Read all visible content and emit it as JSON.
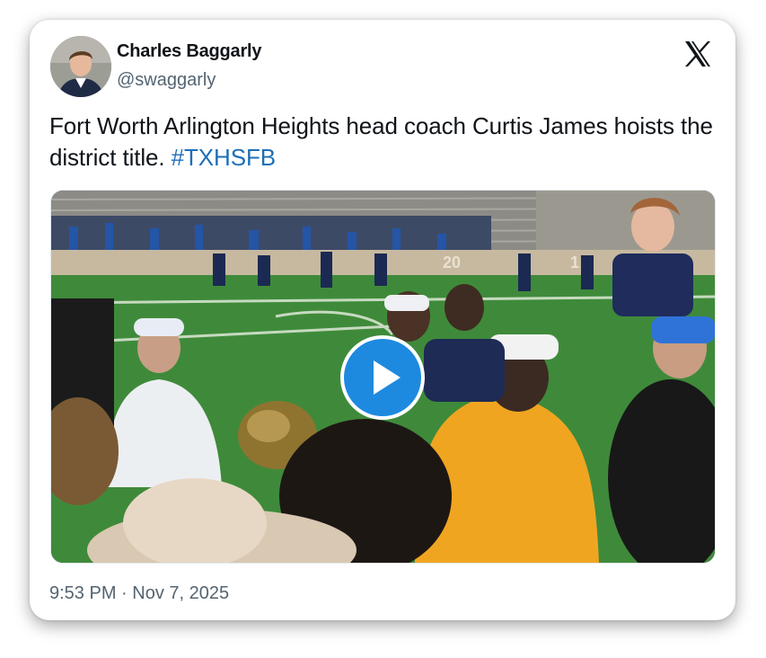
{
  "author": {
    "display_name": "Charles Baggarly",
    "handle": "@swaggarly"
  },
  "tweet": {
    "text": "Fort Worth Arlington Heights head coach Curtis James hoists the district title.",
    "hashtag": "#TXHSFB",
    "timestamp": "9:53 PM · Nov 7, 2025"
  },
  "icons": {
    "platform": "x-logo-icon",
    "play": "play-icon"
  },
  "colors": {
    "hashtag": "#1d6fb8",
    "play_button": "#1d8ae0",
    "text": "#0f1419",
    "muted": "#536471"
  },
  "media": {
    "type": "video",
    "stadium_signage": [
      "20",
      "1"
    ]
  }
}
